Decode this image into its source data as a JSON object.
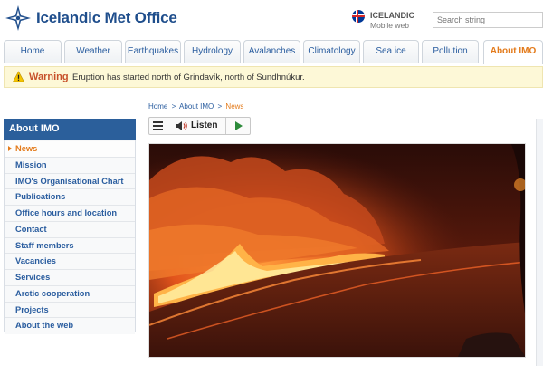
{
  "header": {
    "logo_text": "Icelandic Met Office",
    "language": {
      "title": "ICELANDIC",
      "subtitle": "Mobile web"
    },
    "search": {
      "placeholder": "Search string"
    }
  },
  "nav": {
    "tabs": [
      {
        "label": "Home",
        "active": false
      },
      {
        "label": "Weather",
        "active": false
      },
      {
        "label": "Earthquakes",
        "active": false
      },
      {
        "label": "Hydrology",
        "active": false
      },
      {
        "label": "Avalanches",
        "active": false
      },
      {
        "label": "Climatology",
        "active": false
      },
      {
        "label": "Sea ice",
        "active": false
      },
      {
        "label": "Pollution",
        "active": false
      },
      {
        "label": "About IMO",
        "active": true
      }
    ]
  },
  "warning": {
    "label": "Warning",
    "text": "Eruption has started north of Grindavík, north of Sundhnúkur."
  },
  "breadcrumb": {
    "items": [
      "Home",
      "About IMO",
      "News"
    ],
    "separator": ">"
  },
  "sidebar": {
    "title": "About IMO",
    "items": [
      {
        "label": "News",
        "active": true
      },
      {
        "label": "Mission",
        "active": false
      },
      {
        "label": "IMO's Organisational Chart",
        "active": false
      },
      {
        "label": "Publications",
        "active": false
      },
      {
        "label": "Office hours and location",
        "active": false
      },
      {
        "label": "Contact",
        "active": false
      },
      {
        "label": "Staff members",
        "active": false
      },
      {
        "label": "Vacancies",
        "active": false
      },
      {
        "label": "Services",
        "active": false
      },
      {
        "label": "Arctic cooperation",
        "active": false
      },
      {
        "label": "Projects",
        "active": false
      },
      {
        "label": "About the web",
        "active": false
      }
    ]
  },
  "toolbar": {
    "listen_label": "Listen"
  },
  "colors": {
    "brand_blue": "#2b5f9b",
    "accent_orange": "#e37a1a",
    "warning_bg": "#fdf8d7",
    "warning_text": "#c7502a"
  }
}
